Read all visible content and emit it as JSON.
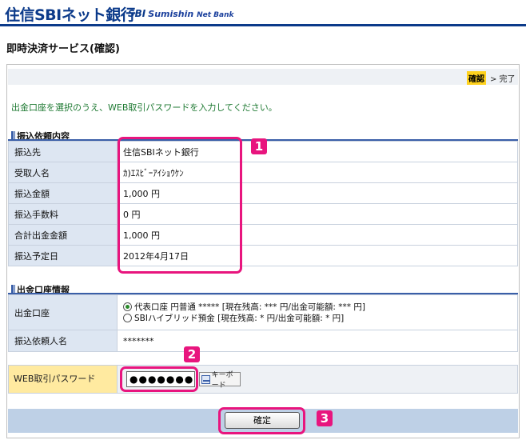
{
  "header": {
    "logo_main": "住信SBIネット銀行",
    "logo_sub_sbi": "SBI",
    "logo_sub_name": "Sumishin",
    "logo_sub_suffix": "Net Bank"
  },
  "page_title": "即時決済サービス(確認)",
  "steps": {
    "current": "確認",
    "rest": "> 完了"
  },
  "instruction": "出金口座を選択のうえ、WEB取引パスワードを入力してください。",
  "transfer_section": {
    "title": "振込依頼内容",
    "rows": [
      {
        "label": "振込先",
        "value": "住信SBIネット銀行"
      },
      {
        "label": "受取人名",
        "value": "ｶ)ｴｽﾋﾞｰｱｲｼｮｳｹﾝ"
      },
      {
        "label": "振込金額",
        "value": "1,000 円"
      },
      {
        "label": "振込手数料",
        "value": "0 円"
      },
      {
        "label": "合計出金金額",
        "value": "1,000 円"
      },
      {
        "label": "振込予定日",
        "value": "2012年4月17日"
      }
    ]
  },
  "account_section": {
    "title": "出金口座情報",
    "account_label": "出金口座",
    "options": [
      {
        "label": "代表口座 円普通 ***** [現在残高: *** 円/出金可能額: *** 円]",
        "selected": true
      },
      {
        "label": "SBIハイブリッド預金 [現在残高: * 円/出金可能額: * 円]",
        "selected": false
      }
    ],
    "requester_label": "振込依頼人名",
    "requester_value": "*******"
  },
  "password": {
    "label": "WEB取引パスワード",
    "value": "●●●●●●●",
    "keyboard_label": "キーボード"
  },
  "confirm_label": "確定",
  "callouts": [
    "1",
    "2",
    "3"
  ],
  "colors": {
    "brand": "#0b3a8a",
    "callout": "#e8157e",
    "instruction": "#1f7a33",
    "highlight": "#ffd21e"
  }
}
